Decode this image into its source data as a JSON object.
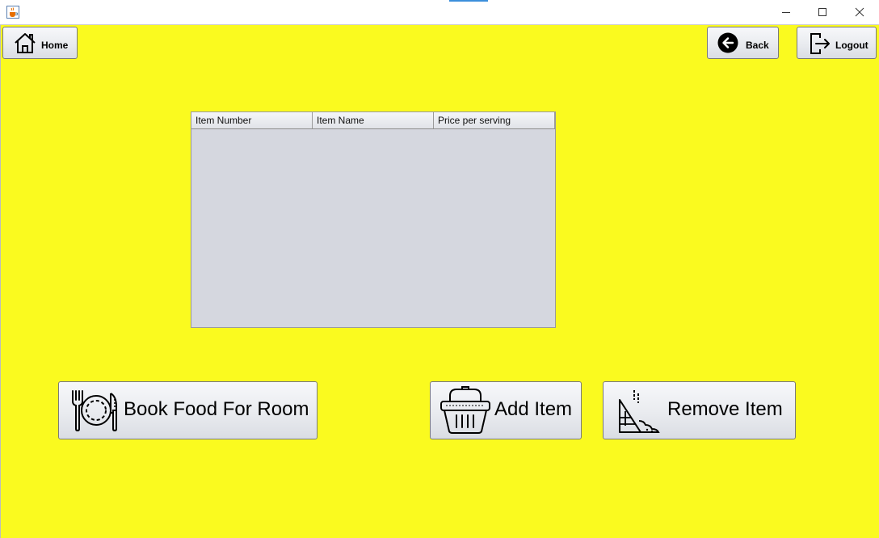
{
  "window": {
    "icon": "java-cup-icon",
    "controls": [
      "minimize",
      "maximize",
      "close"
    ]
  },
  "toolbar": {
    "home_label": "Home",
    "back_label": "Back",
    "logout_label": "Logout"
  },
  "table": {
    "columns": [
      "Item Number",
      "Item Name",
      "Price per serving"
    ],
    "rows": []
  },
  "actions": {
    "book_food_label": "Book Food For Room",
    "add_item_label": "Add Item",
    "remove_item_label": "Remove Item"
  },
  "colors": {
    "background": "#fafa1f",
    "table_body": "#d5d7df"
  }
}
